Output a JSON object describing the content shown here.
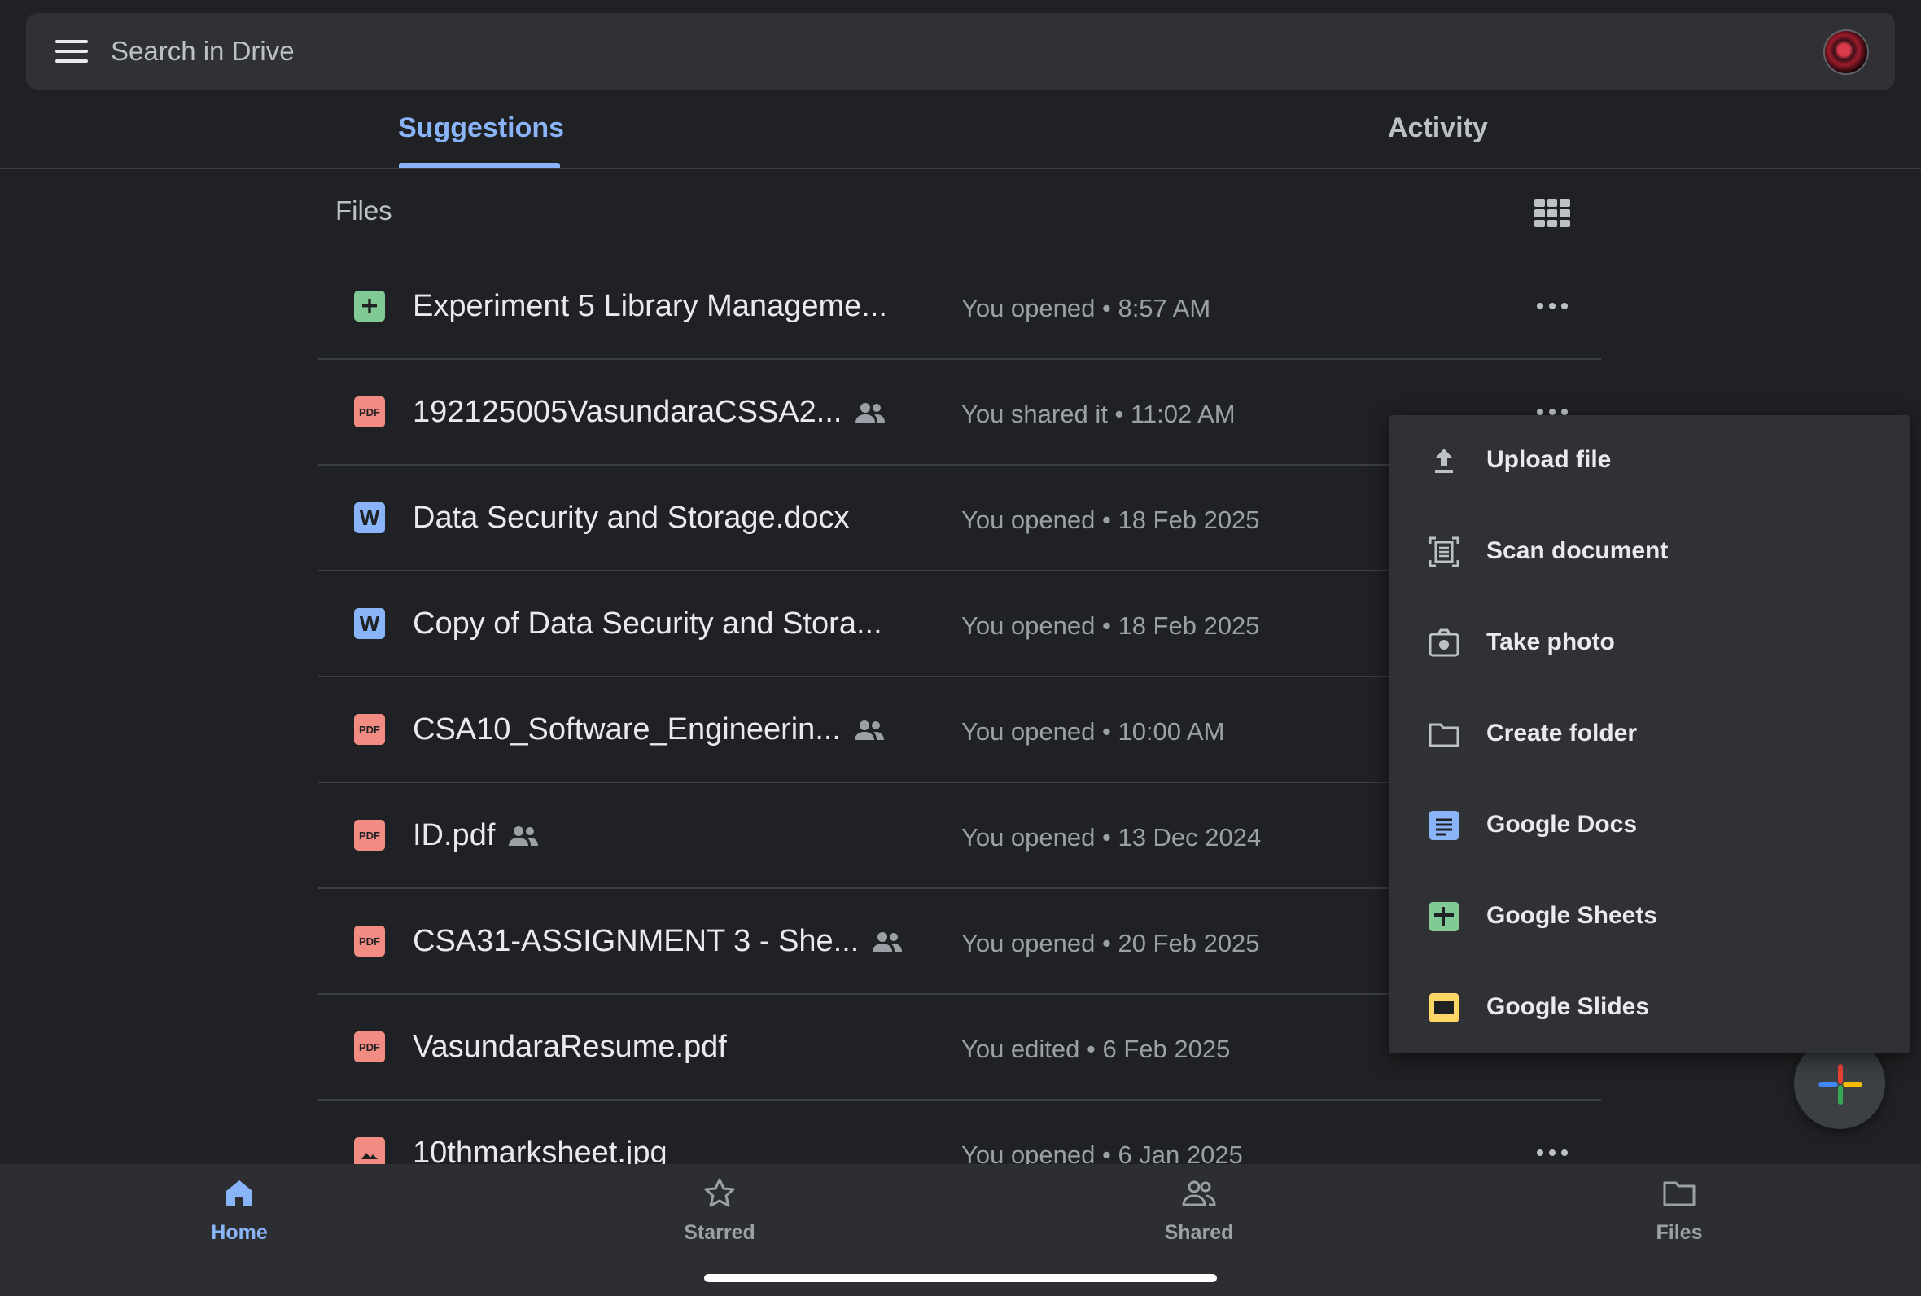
{
  "search": {
    "placeholder": "Search in Drive"
  },
  "tabs": [
    {
      "label": "Suggestions",
      "active": true
    },
    {
      "label": "Activity",
      "active": false
    }
  ],
  "files_heading": "Files",
  "files": [
    {
      "name": "Experiment 5 Library Manageme...",
      "meta": "You opened • 8:57 AM",
      "type": "sheet",
      "shared": false
    },
    {
      "name": "192125005VasundaraCSSA2...",
      "meta": "You shared it • 11:02 AM",
      "type": "pdf",
      "shared": true
    },
    {
      "name": "Data Security and Storage.docx",
      "meta": "You opened • 18 Feb 2025",
      "type": "word",
      "shared": false
    },
    {
      "name": "Copy of Data Security and Stora...",
      "meta": "You opened • 18 Feb 2025",
      "type": "word",
      "shared": false
    },
    {
      "name": "CSA10_Software_Engineerin...",
      "meta": "You opened • 10:00 AM",
      "type": "pdf",
      "shared": true
    },
    {
      "name": "ID.pdf",
      "meta": "You opened • 13 Dec 2024",
      "type": "pdf",
      "shared": true
    },
    {
      "name": "CSA31-ASSIGNMENT 3 - She...",
      "meta": "You opened • 20 Feb 2025",
      "type": "pdf",
      "shared": true
    },
    {
      "name": "VasundaraResume.pdf",
      "meta": "You edited • 6 Feb 2025",
      "type": "pdf",
      "shared": false
    },
    {
      "name": "10thmarksheet.jpg",
      "meta": "You opened • 6 Jan 2025",
      "type": "image",
      "shared": false
    }
  ],
  "file_type_badges": {
    "pdf": "PDF",
    "word": "W"
  },
  "new_menu": {
    "items": [
      {
        "label": "Upload file",
        "icon": "upload-icon"
      },
      {
        "label": "Scan document",
        "icon": "scan-icon"
      },
      {
        "label": "Take photo",
        "icon": "camera-icon"
      },
      {
        "label": "Create folder",
        "icon": "folder-icon"
      },
      {
        "label": "Google Docs",
        "icon": "google-docs-icon"
      },
      {
        "label": "Google Sheets",
        "icon": "google-sheets-icon"
      },
      {
        "label": "Google Slides",
        "icon": "google-slides-icon"
      }
    ]
  },
  "bottom_nav": [
    {
      "label": "Home",
      "icon": "home-icon",
      "active": true
    },
    {
      "label": "Starred",
      "icon": "star-icon",
      "active": false
    },
    {
      "label": "Shared",
      "icon": "shared-people-icon",
      "active": false
    },
    {
      "label": "Files",
      "icon": "folder-icon",
      "active": false
    }
  ],
  "colors": {
    "background": "#202124",
    "surface": "#303134",
    "accent": "#8ab4f8",
    "pdf": "#f28b82",
    "sheets": "#81c995",
    "slides": "#fdd663"
  }
}
